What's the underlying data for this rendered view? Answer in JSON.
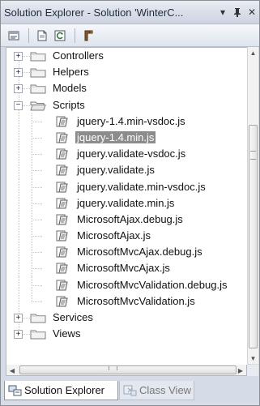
{
  "window": {
    "title": "Solution Explorer - Solution 'WinterC...",
    "pin_glyph": "▾",
    "autohide_glyph": "ᚊ",
    "close_glyph": "✕"
  },
  "toolbar": {
    "buttons": [
      "properties-icon",
      "show-all-files-icon",
      "refresh-icon",
      "class-diagram-icon"
    ]
  },
  "tree": {
    "items": [
      {
        "type": "folder",
        "label": "Controllers",
        "expanded": false
      },
      {
        "type": "folder",
        "label": "Helpers",
        "expanded": false
      },
      {
        "type": "folder",
        "label": "Models",
        "expanded": false
      },
      {
        "type": "folder",
        "label": "Scripts",
        "expanded": true
      },
      {
        "type": "file",
        "label": "jquery-1.4.min-vsdoc.js"
      },
      {
        "type": "file",
        "label": "jquery-1.4.min.js",
        "selected": true
      },
      {
        "type": "file",
        "label": "jquery.validate-vsdoc.js"
      },
      {
        "type": "file",
        "label": "jquery.validate.js"
      },
      {
        "type": "file",
        "label": "jquery.validate.min-vsdoc.js"
      },
      {
        "type": "file",
        "label": "jquery.validate.min.js"
      },
      {
        "type": "file",
        "label": "MicrosoftAjax.debug.js"
      },
      {
        "type": "file",
        "label": "MicrosoftAjax.js"
      },
      {
        "type": "file",
        "label": "MicrosoftMvcAjax.debug.js"
      },
      {
        "type": "file",
        "label": "MicrosoftMvcAjax.js"
      },
      {
        "type": "file",
        "label": "MicrosoftMvcValidation.debug.js"
      },
      {
        "type": "file",
        "label": "MicrosoftMvcValidation.js"
      },
      {
        "type": "folder",
        "label": "Services",
        "expanded": false
      },
      {
        "type": "folder",
        "label": "Views",
        "expanded": false
      }
    ]
  },
  "scrollbars": {
    "up": "▲",
    "down": "▼",
    "left": "◀",
    "right": "▶",
    "h_grip": "III",
    "v_grip": "≡"
  },
  "tabs": [
    {
      "label": "Solution Explorer",
      "active": true,
      "icon": "solution-explorer-icon"
    },
    {
      "label": "Class View",
      "active": false,
      "icon": "class-view-icon"
    }
  ]
}
